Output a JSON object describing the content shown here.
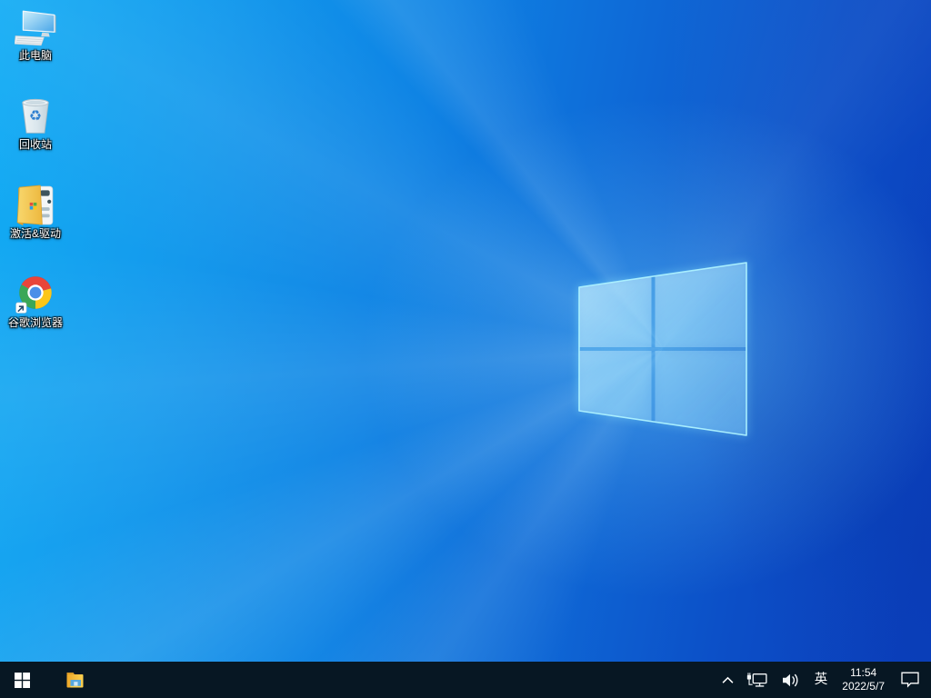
{
  "desktop": {
    "wallpaper": "windows-10-light-logo",
    "icons": [
      {
        "label": "此电脑"
      },
      {
        "label": "回收站"
      },
      {
        "label": "激活&驱动"
      },
      {
        "label": "谷歌浏览器"
      }
    ]
  },
  "taskbar": {
    "tray": {
      "ime_language": "英",
      "time": "11:54",
      "date": "2022/5/7"
    }
  },
  "colors": {
    "taskbar_bg": "#071723",
    "wallpaper_bright": "#0caaf4",
    "wallpaper_dark": "#0b40bd",
    "logo_edge": "#aef2ff"
  }
}
